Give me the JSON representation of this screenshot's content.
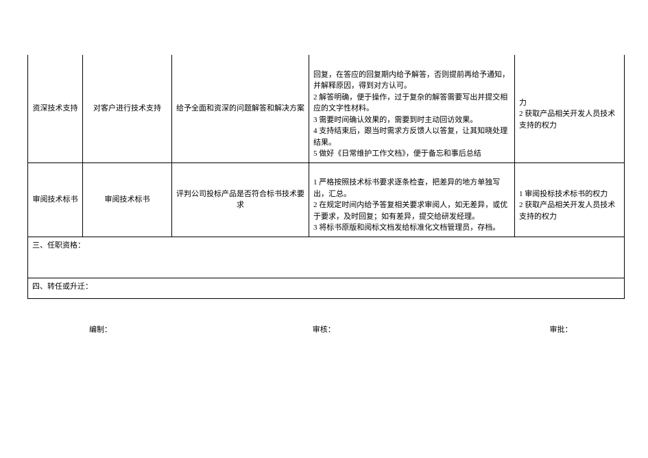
{
  "rows": [
    {
      "col_a": "资深技术支持",
      "col_b": "对客户进行技术支持",
      "col_c": "给予全面和资深的问题解答和解决方案",
      "col_d": "回复，在答应的回复期内给予解答，否则提前再给予通知，并解释原因，得到对方认可。\n2 解答明确，便于操作，过于复杂的解答需要写出并提交相应的文字性材料。\n3 需要时间确认效果的，需要到时主动回访效果。\n4 支持结束后，跟当时需求方反馈人以答复，让其知晓处理结果。\n5 做好《日常维护工作文档》，便于备忘和事后总结",
      "col_e": "力\n2 获取产品相关开发人员技术支持的权力"
    },
    {
      "col_a": "审阅技术标书",
      "col_b": "审阅技术标书",
      "col_c": "评判公司投标产品是否符合标书技术要求",
      "col_d": "1 严格按照技术标书要求逐条检查，把差异的地方单独写出，汇总。\n2 在规定时间内给予答复相关要求审阅人，如无差异，或优于要求，及时回复；如有差异，提交给研发经理。\n3 将标书原版和阅标文档发给标准化文档管理员，存档。",
      "col_e": "1 审阅投标技术标书的权力\n2 获取产品相关开发人员技术支持的权力"
    }
  ],
  "sections": {
    "qualification": "三、任职资格：",
    "transfer": "四、转任或升迁："
  },
  "footer": {
    "prepare": "编制：",
    "review": "审核：",
    "approve": "审批："
  }
}
